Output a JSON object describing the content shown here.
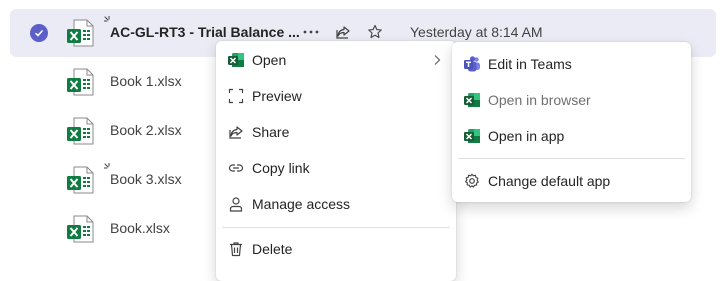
{
  "files": [
    {
      "name": "AC-GL-RT3 - Trial Balance ...",
      "date": "Yesterday at 8:14 AM",
      "selected": true,
      "is_new": true
    },
    {
      "name": "Book 1.xlsx",
      "date": "",
      "selected": false,
      "is_new": false
    },
    {
      "name": "Book 2.xlsx",
      "date": "",
      "selected": false,
      "is_new": false
    },
    {
      "name": "Book 3.xlsx",
      "date": "",
      "selected": false,
      "is_new": true
    },
    {
      "name": "Book.xlsx",
      "date": "",
      "selected": false,
      "is_new": false
    }
  ],
  "context_menu": {
    "items": [
      {
        "label": "Open",
        "icon": "excel-icon",
        "has_submenu": true
      },
      {
        "label": "Preview",
        "icon": "preview-icon"
      },
      {
        "label": "Share",
        "icon": "share-icon"
      },
      {
        "label": "Copy link",
        "icon": "link-icon"
      },
      {
        "label": "Manage access",
        "icon": "person-icon"
      },
      {
        "label": "Delete",
        "icon": "trash-icon"
      }
    ]
  },
  "submenu": {
    "items": [
      {
        "label": "Edit in Teams",
        "icon": "teams-icon"
      },
      {
        "label": "Open in browser",
        "icon": "excel-icon"
      },
      {
        "label": "Open in app",
        "icon": "excel-icon"
      },
      {
        "label": "Change default app",
        "icon": "gear-icon"
      }
    ]
  },
  "colors": {
    "accent": "#5b5fc7",
    "excel": "#107c41",
    "teams": "#5b5fc7",
    "selected_row": "#ebebf5"
  }
}
